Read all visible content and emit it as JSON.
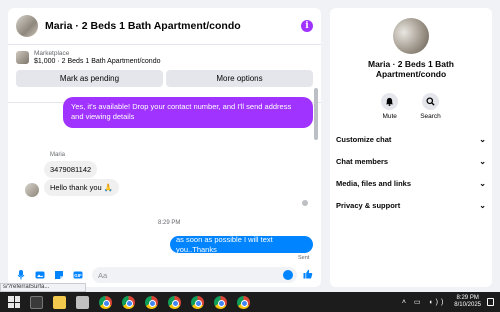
{
  "chat": {
    "title": "Maria · 2 Beds 1 Bath Apartment/condo",
    "info_icon": "info-icon",
    "marketplace_label": "Marketplace",
    "listing": "$1,000 · 2 Beds 1 Bath Apartment/condo",
    "mark_pending": "Mark as pending",
    "more_options": "More options"
  },
  "messages": {
    "outgoing_1": "Yes, it's available! Drop your contact number, and I'll send address and viewing details",
    "sender_name": "Maria",
    "incoming_1": "3479081142",
    "incoming_2": "Hello thank you 🙏",
    "timestamp": "8:29 PM",
    "outgoing_2": "as soon as possible I will text you..Thanks",
    "status": "Sent"
  },
  "composer": {
    "placeholder": "Aa",
    "icons": [
      "microphone-icon",
      "image-icon",
      "sticker-icon",
      "gif-icon",
      "emoji-icon",
      "thumbs-up-icon"
    ]
  },
  "sidebar": {
    "name": "Maria · 2 Beds 1 Bath Apartment/condo",
    "mute_label": "Mute",
    "search_label": "Search",
    "menu": [
      "Customize chat",
      "Chat members",
      "Media, files and links",
      "Privacy & support"
    ]
  },
  "status_url": "s/?referralSurfa...",
  "taskbar": {
    "time": "8:29 PM",
    "date": "8/10/2025"
  },
  "colors": {
    "accent_blue": "#0084ff",
    "accent_purple": "#a033ff"
  }
}
